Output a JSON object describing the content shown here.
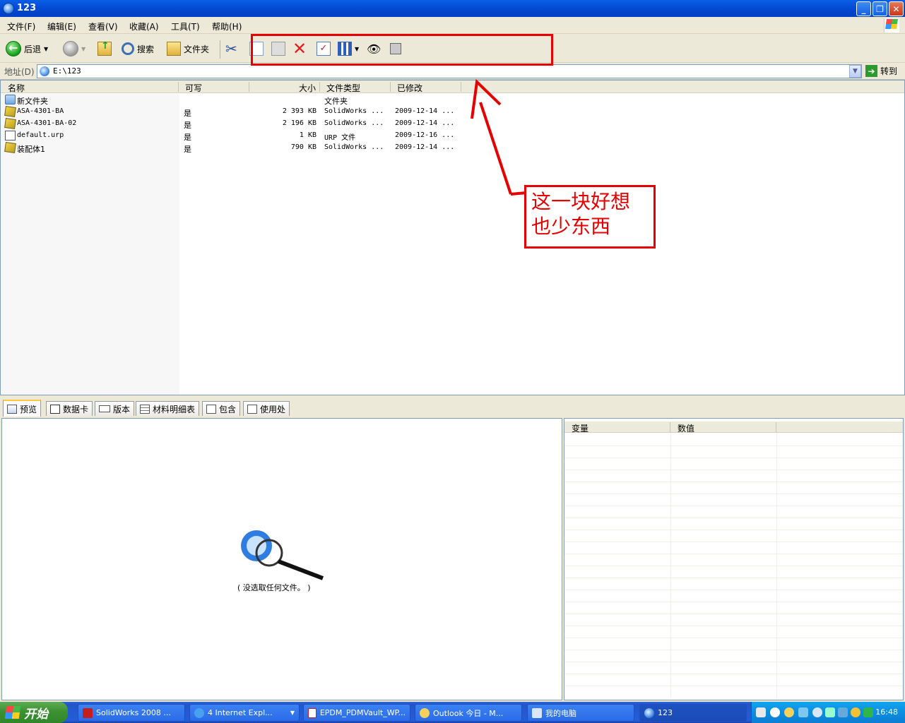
{
  "window": {
    "title": "123"
  },
  "menu": [
    "文件(F)",
    "编辑(E)",
    "查看(V)",
    "收藏(A)",
    "工具(T)",
    "帮助(H)"
  ],
  "toolbar": {
    "back": "后退",
    "search": "搜索",
    "folders": "文件夹"
  },
  "address": {
    "label": "地址(D)",
    "value": "E:\\123",
    "go": "转到"
  },
  "columns": [
    "名称",
    "可写",
    "大小",
    "文件类型",
    "已修改"
  ],
  "files": [
    {
      "name": "新文件夹",
      "writable": "",
      "size": "",
      "type": "文件夹",
      "modified": ""
    },
    {
      "name": "ASA-4301-BA",
      "writable": "是",
      "size": "2 393 KB",
      "type": "SolidWorks ...",
      "modified": "2009-12-14 ..."
    },
    {
      "name": "ASA-4301-BA-02",
      "writable": "是",
      "size": "2 196 KB",
      "type": "SolidWorks ...",
      "modified": "2009-12-14 ..."
    },
    {
      "name": "default.urp",
      "writable": "是",
      "size": "1 KB",
      "type": "URP 文件",
      "modified": "2009-12-16 ..."
    },
    {
      "name": "装配体1",
      "writable": "是",
      "size": "790 KB",
      "type": "SolidWorks ...",
      "modified": "2009-12-14 ..."
    }
  ],
  "annotation": {
    "line1": "这一块好想",
    "line2": "也少东西"
  },
  "tabs": [
    "预览",
    "数据卡",
    "版本",
    "材料明细表",
    "包含",
    "使用处"
  ],
  "preview": {
    "caption": "( 没选取任何文件。 )"
  },
  "var_columns": [
    "变量",
    "数值"
  ],
  "taskbar": {
    "start": "开始",
    "tasks": [
      "SolidWorks 2008 ...",
      "4 Internet Expl...",
      "EPDM_PDMVault_WP...",
      "Outlook 今日 - M...",
      "我的电脑",
      "123"
    ],
    "clock": "16:48"
  },
  "colors": {
    "annotation": "#e60000",
    "titlebar": "#0349d2",
    "taskbar": "#245cd8"
  }
}
